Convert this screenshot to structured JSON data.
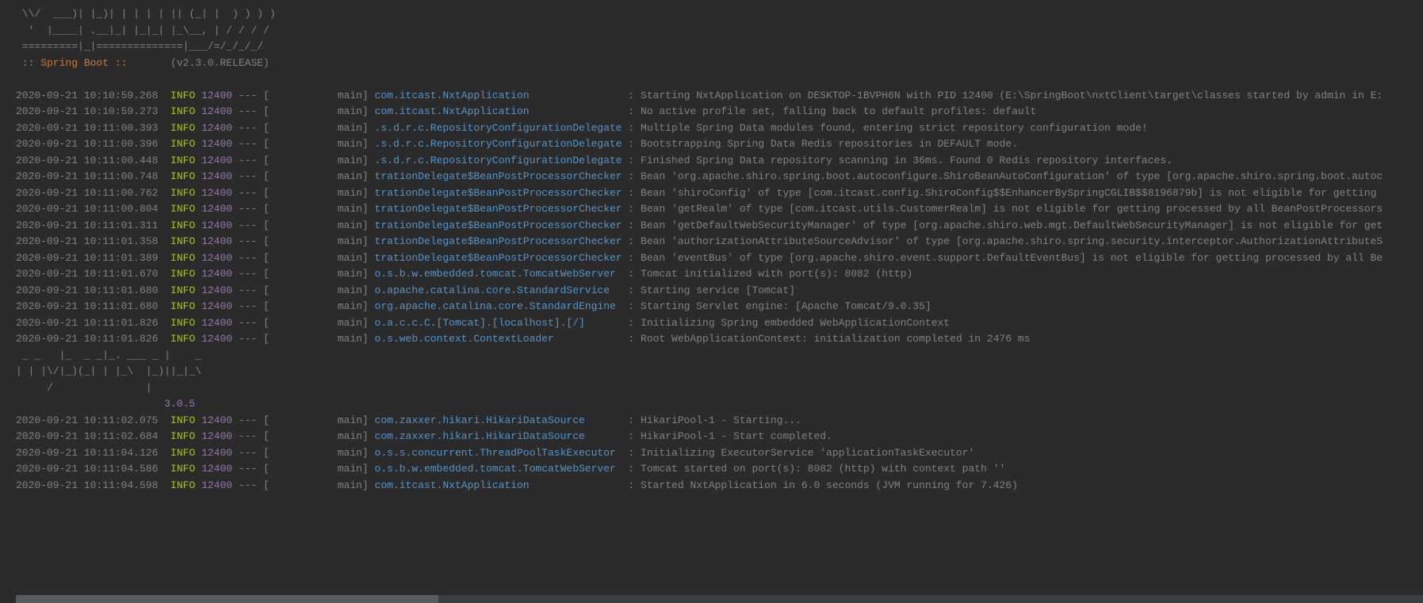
{
  "ascii": [
    " \\\\/  ___)| |_)| | | | | || (_| |  ) ) ) )",
    "  '  |____| .__|_| |_|_| |_\\__, | / / / /",
    " =========|_|==============|___/=/_/_/_/",
    " :: Spring Boot ::       (v2.3.0.RELEASE)",
    ""
  ],
  "ascii2": [
    " _ _   |_  _ _|_. ___ _ |    _ ",
    "| | |\\/|_)(_| | |_\\  |_)||_|_\\ ",
    "     /               |         ",
    "                        3.0.5 "
  ],
  "logs": [
    {
      "ts": "2020-09-21 10:10:59.268",
      "lvl": "INFO",
      "pid": "12400",
      "thread": "main",
      "logger": "com.itcast.NxtApplication",
      "msg": "Starting NxtApplication on DESKTOP-1BVPH6N with PID 12400 (E:\\SpringBoot\\nxtClient\\target\\classes started by admin in E:"
    },
    {
      "ts": "2020-09-21 10:10:59.273",
      "lvl": "INFO",
      "pid": "12400",
      "thread": "main",
      "logger": "com.itcast.NxtApplication",
      "msg": "No active profile set, falling back to default profiles: default"
    },
    {
      "ts": "2020-09-21 10:11:00.393",
      "lvl": "INFO",
      "pid": "12400",
      "thread": "main",
      "logger": ".s.d.r.c.RepositoryConfigurationDelegate",
      "msg": "Multiple Spring Data modules found, entering strict repository configuration mode!"
    },
    {
      "ts": "2020-09-21 10:11:00.396",
      "lvl": "INFO",
      "pid": "12400",
      "thread": "main",
      "logger": ".s.d.r.c.RepositoryConfigurationDelegate",
      "msg": "Bootstrapping Spring Data Redis repositories in DEFAULT mode."
    },
    {
      "ts": "2020-09-21 10:11:00.448",
      "lvl": "INFO",
      "pid": "12400",
      "thread": "main",
      "logger": ".s.d.r.c.RepositoryConfigurationDelegate",
      "msg": "Finished Spring Data repository scanning in 36ms. Found 0 Redis repository interfaces."
    },
    {
      "ts": "2020-09-21 10:11:00.748",
      "lvl": "INFO",
      "pid": "12400",
      "thread": "main",
      "logger": "trationDelegate$BeanPostProcessorChecker",
      "msg": "Bean 'org.apache.shiro.spring.boot.autoconfigure.ShiroBeanAutoConfiguration' of type [org.apache.shiro.spring.boot.autoc"
    },
    {
      "ts": "2020-09-21 10:11:00.762",
      "lvl": "INFO",
      "pid": "12400",
      "thread": "main",
      "logger": "trationDelegate$BeanPostProcessorChecker",
      "msg": "Bean 'shiroConfig' of type [com.itcast.config.ShiroConfig$$EnhancerBySpringCGLIB$$8196879b] is not eligible for getting"
    },
    {
      "ts": "2020-09-21 10:11:00.804",
      "lvl": "INFO",
      "pid": "12400",
      "thread": "main",
      "logger": "trationDelegate$BeanPostProcessorChecker",
      "msg": "Bean 'getRealm' of type [com.itcast.utils.CustomerRealm] is not eligible for getting processed by all BeanPostProcessors"
    },
    {
      "ts": "2020-09-21 10:11:01.311",
      "lvl": "INFO",
      "pid": "12400",
      "thread": "main",
      "logger": "trationDelegate$BeanPostProcessorChecker",
      "msg": "Bean 'getDefaultWebSecurityManager' of type [org.apache.shiro.web.mgt.DefaultWebSecurityManager] is not eligible for get"
    },
    {
      "ts": "2020-09-21 10:11:01.358",
      "lvl": "INFO",
      "pid": "12400",
      "thread": "main",
      "logger": "trationDelegate$BeanPostProcessorChecker",
      "msg": "Bean 'authorizationAttributeSourceAdvisor' of type [org.apache.shiro.spring.security.interceptor.AuthorizationAttributeS"
    },
    {
      "ts": "2020-09-21 10:11:01.389",
      "lvl": "INFO",
      "pid": "12400",
      "thread": "main",
      "logger": "trationDelegate$BeanPostProcessorChecker",
      "msg": "Bean 'eventBus' of type [org.apache.shiro.event.support.DefaultEventBus] is not eligible for getting processed by all Be"
    },
    {
      "ts": "2020-09-21 10:11:01.670",
      "lvl": "INFO",
      "pid": "12400",
      "thread": "main",
      "logger": "o.s.b.w.embedded.tomcat.TomcatWebServer",
      "msg": "Tomcat initialized with port(s): 8082 (http)"
    },
    {
      "ts": "2020-09-21 10:11:01.680",
      "lvl": "INFO",
      "pid": "12400",
      "thread": "main",
      "logger": "o.apache.catalina.core.StandardService",
      "msg": "Starting service [Tomcat]"
    },
    {
      "ts": "2020-09-21 10:11:01.680",
      "lvl": "INFO",
      "pid": "12400",
      "thread": "main",
      "logger": "org.apache.catalina.core.StandardEngine",
      "msg": "Starting Servlet engine: [Apache Tomcat/9.0.35]"
    },
    {
      "ts": "2020-09-21 10:11:01.826",
      "lvl": "INFO",
      "pid": "12400",
      "thread": "main",
      "logger": "o.a.c.c.C.[Tomcat].[localhost].[/]",
      "msg": "Initializing Spring embedded WebApplicationContext"
    },
    {
      "ts": "2020-09-21 10:11:01.826",
      "lvl": "INFO",
      "pid": "12400",
      "thread": "main",
      "logger": "o.s.web.context.ContextLoader",
      "msg": "Root WebApplicationContext: initialization completed in 2476 ms"
    }
  ],
  "logs2": [
    {
      "ts": "2020-09-21 10:11:02.075",
      "lvl": "INFO",
      "pid": "12400",
      "thread": "main",
      "logger": "com.zaxxer.hikari.HikariDataSource",
      "msg": "HikariPool-1 - Starting..."
    },
    {
      "ts": "2020-09-21 10:11:02.684",
      "lvl": "INFO",
      "pid": "12400",
      "thread": "main",
      "logger": "com.zaxxer.hikari.HikariDataSource",
      "msg": "HikariPool-1 - Start completed."
    },
    {
      "ts": "2020-09-21 10:11:04.126",
      "lvl": "INFO",
      "pid": "12400",
      "thread": "main",
      "logger": "o.s.s.concurrent.ThreadPoolTaskExecutor",
      "msg": "Initializing ExecutorService 'applicationTaskExecutor'"
    },
    {
      "ts": "2020-09-21 10:11:04.586",
      "lvl": "INFO",
      "pid": "12400",
      "thread": "main",
      "logger": "o.s.b.w.embedded.tomcat.TomcatWebServer",
      "msg": "Tomcat started on port(s): 8082 (http) with context path ''"
    },
    {
      "ts": "2020-09-21 10:11:04.598",
      "lvl": "INFO",
      "pid": "12400",
      "thread": "main",
      "logger": "com.itcast.NxtApplication",
      "msg": "Started NxtApplication in 6.0 seconds (JVM running for 7.426)"
    }
  ]
}
